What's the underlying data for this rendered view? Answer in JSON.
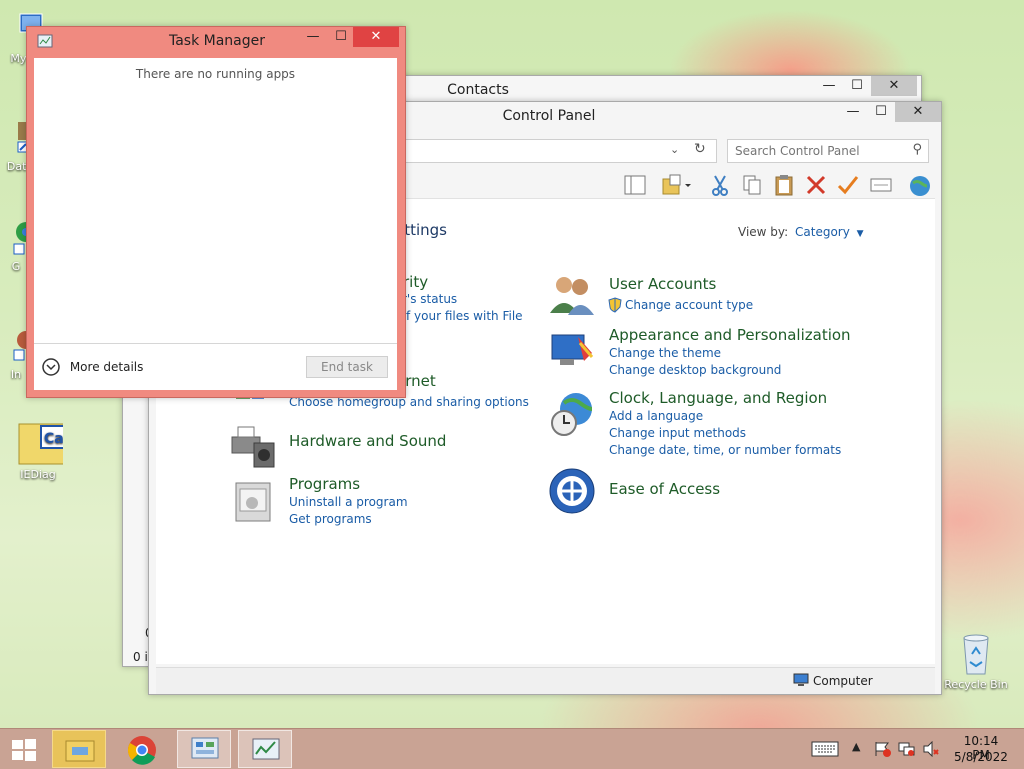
{
  "desktop": {
    "icons": [
      {
        "label": "My C"
      },
      {
        "label": "Data"
      },
      {
        "label": "G"
      },
      {
        "label": "In"
      },
      {
        "label": "IEDiag"
      },
      {
        "label": "Recycle Bin"
      }
    ]
  },
  "contacts": {
    "title": "Contacts",
    "status_left": "0 it",
    "left_num": "0"
  },
  "control_panel": {
    "title": "Control Panel",
    "search_placeholder": "Search Control Panel",
    "heading_fragment": "ettings",
    "view_by_label": "View by:",
    "view_by_value": "Category",
    "status_computer": "Computer",
    "left_categories": [
      {
        "title": "rity",
        "links": [
          "r's status",
          "f your files with File"
        ]
      },
      {
        "title": "ernet",
        "links": [
          "Choose homegroup and sharing options"
        ]
      },
      {
        "title": "Hardware and Sound",
        "links": []
      },
      {
        "title": "Programs",
        "links": [
          "Uninstall a program",
          "Get programs"
        ]
      }
    ],
    "right_categories": [
      {
        "title": "User Accounts",
        "links": [
          "Change account type"
        ]
      },
      {
        "title": "Appearance and Personalization",
        "links": [
          "Change the theme",
          "Change desktop background"
        ]
      },
      {
        "title": "Clock, Language, and Region",
        "links": [
          "Add a language",
          "Change input methods",
          "Change date, time, or number formats"
        ]
      },
      {
        "title": "Ease of Access",
        "links": []
      }
    ]
  },
  "task_manager": {
    "title": "Task Manager",
    "empty_message": "There are no running apps",
    "more_details": "More details",
    "end_task": "End task"
  },
  "window_controls": {
    "minimize": "—",
    "maximize": "☐",
    "close": "✕"
  },
  "taskbar": {
    "time": "10:14 PM",
    "date": "5/8/2022"
  }
}
